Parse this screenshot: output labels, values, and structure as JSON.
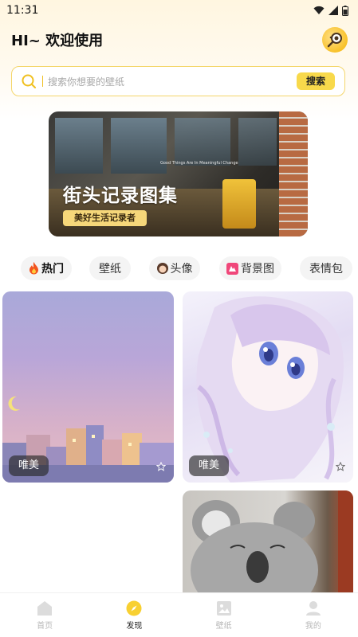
{
  "status_bar": {
    "time": "11:31"
  },
  "header": {
    "greeting": "HI~ 欢迎使用"
  },
  "search": {
    "placeholder": "搜索你想要的壁纸",
    "button_label": "搜索"
  },
  "banner": {
    "small_text": "Good Things Are In Meaningful Change",
    "title": "街头记录图集",
    "subtitle": "美好生活记录者"
  },
  "tabs": [
    {
      "label": "热门",
      "icon": "fire-icon"
    },
    {
      "label": "壁纸",
      "icon": ""
    },
    {
      "label": "头像",
      "icon": "girl-icon"
    },
    {
      "label": "背景图",
      "icon": "grid-icon"
    },
    {
      "label": "表情包",
      "icon": ""
    }
  ],
  "cards": [
    {
      "tag": "唯美",
      "subject": "moon-over-town"
    },
    {
      "tag": "唯美",
      "subject": "anime-girl"
    },
    {
      "tag": "",
      "subject": "koala"
    }
  ],
  "bottom_nav": [
    {
      "label": "首页",
      "icon": "home-icon"
    },
    {
      "label": "发现",
      "icon": "compass-icon"
    },
    {
      "label": "壁纸",
      "icon": "image-icon"
    },
    {
      "label": "我的",
      "icon": "user-icon"
    }
  ],
  "colors": {
    "accent": "#f8d94b",
    "search_border": "#f4d66b",
    "header_bg": "#fff6e0"
  }
}
